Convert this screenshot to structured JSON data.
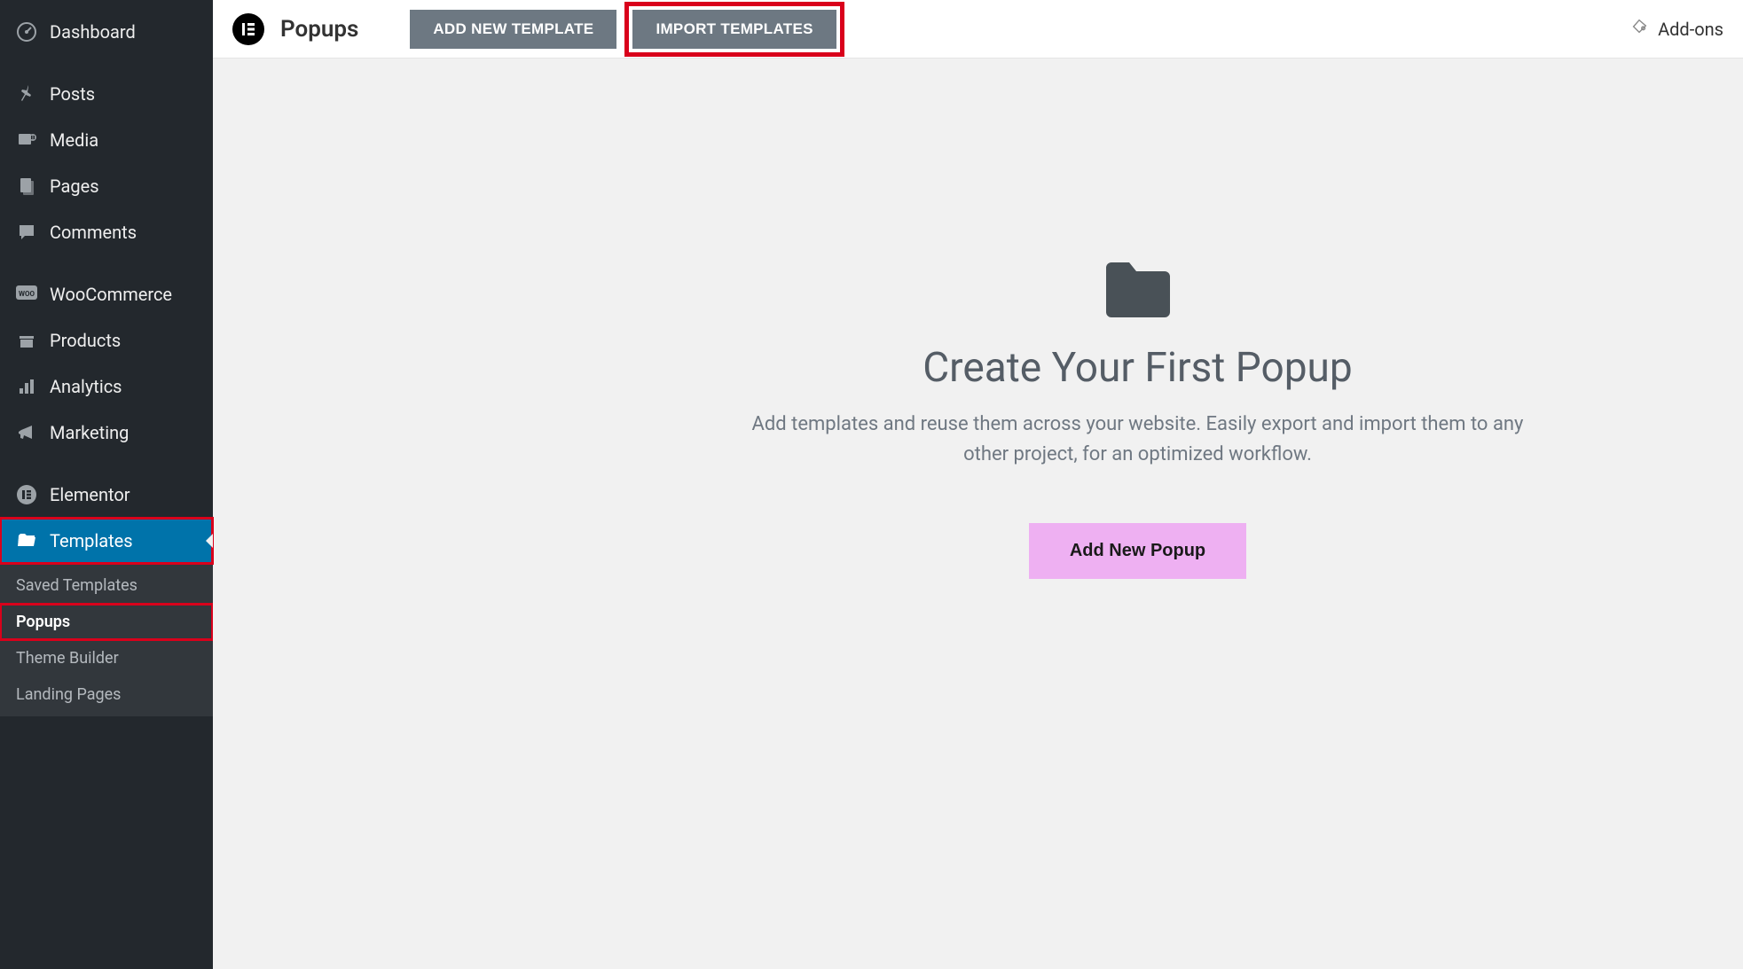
{
  "sidebar": {
    "items": [
      {
        "label": "Dashboard",
        "icon": "dashboard"
      },
      {
        "label": "Posts",
        "icon": "pin"
      },
      {
        "label": "Media",
        "icon": "media"
      },
      {
        "label": "Pages",
        "icon": "pages"
      },
      {
        "label": "Comments",
        "icon": "comment"
      },
      {
        "label": "WooCommerce",
        "icon": "woo"
      },
      {
        "label": "Products",
        "icon": "products"
      },
      {
        "label": "Analytics",
        "icon": "analytics"
      },
      {
        "label": "Marketing",
        "icon": "marketing"
      },
      {
        "label": "Elementor",
        "icon": "elementor"
      },
      {
        "label": "Templates",
        "icon": "folder-open"
      }
    ],
    "submenu": [
      {
        "label": "Saved Templates"
      },
      {
        "label": "Popups"
      },
      {
        "label": "Theme Builder"
      },
      {
        "label": "Landing Pages"
      }
    ]
  },
  "topbar": {
    "title": "Popups",
    "add_new_label": "ADD NEW TEMPLATE",
    "import_label": "IMPORT TEMPLATES",
    "addons_label": "Add-ons"
  },
  "hero": {
    "title": "Create Your First Popup",
    "description": "Add templates and reuse them across your website. Easily export and import them to any other project, for an optimized workflow.",
    "button_label": "Add New Popup"
  }
}
